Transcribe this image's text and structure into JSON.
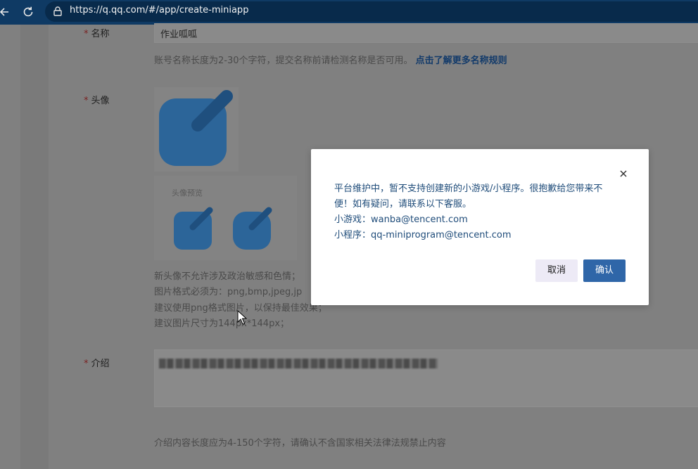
{
  "browser": {
    "url": "https://q.qq.com/#/app/create-miniapp"
  },
  "form": {
    "name": {
      "required_mark": "*",
      "label": "名称",
      "value": "作业呱呱",
      "hint": "账号名称长度为2-30个字符，提交名称前请检测名称是否可用。",
      "hint_link": "点击了解更多名称规则"
    },
    "avatar": {
      "required_mark": "*",
      "label": "头像",
      "preview_label": "头像预览",
      "hints": [
        "新头像不允许涉及政治敏感和色情；",
        "图片格式必须为：png,bmp,jpeg,jp",
        "建议使用png格式图片，以保持最佳效果；",
        "建议图片尺寸为144px*144px；"
      ]
    },
    "intro": {
      "required_mark": "*",
      "label": "介绍",
      "hint": "介绍内容长度应为4-150个字符，请确认不含国家相关法律法规禁止内容"
    }
  },
  "modal": {
    "message_lines": [
      "平台维护中，暂不支持创建新的小游戏/小程序。很抱歉给您带来不",
      "便！如有疑问，请联系以下客服。",
      "小游戏：wanba@tencent.com",
      "小程序：qq-miniprogram@tencent.com"
    ],
    "cancel_label": "取消",
    "confirm_label": "确认"
  },
  "colors": {
    "accent": "#2f66a8",
    "icon_blue": "#2c6599",
    "overlay": "#808080"
  }
}
